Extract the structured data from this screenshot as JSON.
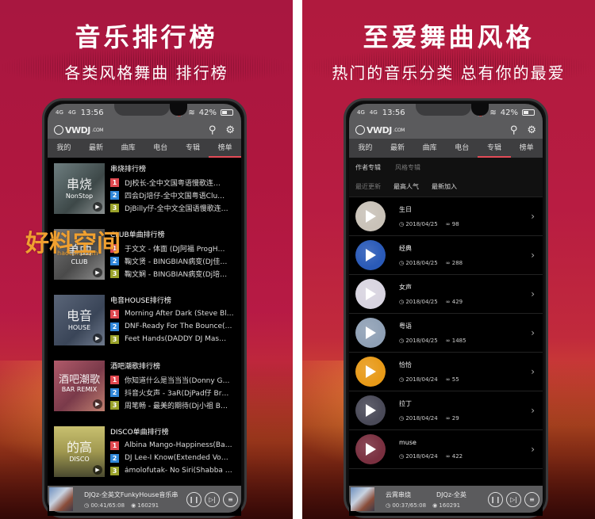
{
  "left_panel": {
    "headline": "音乐排行榜",
    "subline": "各类风格舞曲 排行榜",
    "status": {
      "signal1": "4G",
      "signal2": "4G",
      "time": "13:56",
      "battery": "42%"
    },
    "app": {
      "logo": "VWDJ",
      "logo_suffix": ".COM",
      "search_icon": "search-icon",
      "settings_icon": "gear-icon"
    },
    "tabs": [
      {
        "label": "我的"
      },
      {
        "label": "最新"
      },
      {
        "label": "曲库"
      },
      {
        "label": "电台"
      },
      {
        "label": "专辑"
      },
      {
        "label": "榜单",
        "active": true
      }
    ],
    "charts": [
      {
        "title": "串烧排行榜",
        "cover_big": "串烧",
        "cover_small": "NonStop",
        "tracks": [
          "DJ校长-全中文国粤语慢歌连…",
          "四会Dj培仔-全中文国粤语Clu…",
          "DjBilly仔-全中文全国语慢歌连…"
        ]
      },
      {
        "title": "CLUB单曲排行榜",
        "cover_big": "单曲",
        "cover_small": "CLUB",
        "tracks": [
          "于文文 - 体面 (DJ阿福 ProgH…",
          "鞠文贤 - BINGBIAN病变(DJ佳…",
          "鞠文娴 - BINGBIAN病变(Dj培…"
        ]
      },
      {
        "title": "电音HOUSE排行榜",
        "cover_big": "电音",
        "cover_small": "HOUSE",
        "tracks": [
          "Morning After Dark (Steve Bl…",
          "DNF-Ready For The Bounce(…",
          "Feet Hands(DADDY DJ Mas…"
        ]
      },
      {
        "title": "酒吧潮歌排行榜",
        "cover_big": "酒吧潮歌",
        "cover_small": "BAR REMIX",
        "tracks": [
          "你知道什么是当当当(Donny G…",
          "抖音火女声 - 3aR(DjPad仔 Br…",
          "周笔畅 - 最美的期待(Dj小祖 B…"
        ]
      },
      {
        "title": "DISCO单曲排行榜",
        "cover_big": "的高",
        "cover_small": "DISCO",
        "tracks": [
          "Albina Mango-Happiness(Ba…",
          "DJ Lee-I Know(Extended Vo…",
          "ámolofutak- No Siri(Shabba D…"
        ]
      }
    ],
    "player": {
      "title": "DJQz-全英文FunkyHouse音乐串",
      "time": "00:41/65:08",
      "plays": "160291"
    }
  },
  "right_panel": {
    "headline": "至爱舞曲风格",
    "subline": "热门的音乐分类 总有你的最爱",
    "status": {
      "signal1": "4G",
      "signal2": "4G",
      "time": "13:56",
      "battery": "42%"
    },
    "app": {
      "logo": "VWDJ",
      "logo_suffix": ".COM"
    },
    "tabs": [
      {
        "label": "我的"
      },
      {
        "label": "最新"
      },
      {
        "label": "曲库"
      },
      {
        "label": "电台"
      },
      {
        "label": "专辑",
        "active": true
      },
      {
        "label": "榜单"
      }
    ],
    "subtabs": [
      "作者专辑",
      "风格专辑"
    ],
    "sorts": [
      "最近更新",
      "最高人气",
      "最新加入"
    ],
    "albums": [
      {
        "name": "生日",
        "date": "2018/04/25",
        "count": "98",
        "color": "#c9c2b8"
      },
      {
        "name": "经典",
        "date": "2018/04/25",
        "count": "288",
        "color": "#2a5ab8"
      },
      {
        "name": "女声",
        "date": "2018/04/25",
        "count": "429",
        "color": "#d8d4e0"
      },
      {
        "name": "粤语",
        "date": "2018/04/25",
        "count": "1485",
        "color": "#8fa0b5"
      },
      {
        "name": "恰恰",
        "date": "2018/04/24",
        "count": "55",
        "color": "#e89a18"
      },
      {
        "name": "拉丁",
        "date": "2018/04/24",
        "count": "29",
        "color": "#4a4a58"
      },
      {
        "name": "muse",
        "date": "2018/04/24",
        "count": "422",
        "color": "#7a3040"
      }
    ],
    "player": {
      "title": "云霄串烧",
      "title2": "DJQz-全英",
      "time": "00:37/65:08",
      "plays": "160291"
    }
  },
  "watermark": {
    "text": "好料空间",
    "url": "haocom.com"
  }
}
